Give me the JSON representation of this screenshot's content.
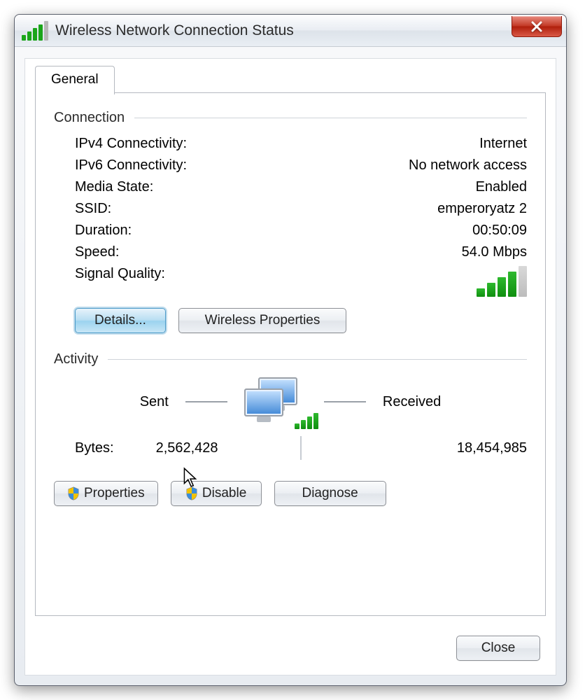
{
  "window": {
    "title": "Wireless Network Connection Status"
  },
  "tabs": {
    "general": "General"
  },
  "connection": {
    "heading": "Connection",
    "ipv4_label": "IPv4 Connectivity:",
    "ipv4_value": "Internet",
    "ipv6_label": "IPv6 Connectivity:",
    "ipv6_value": "No network access",
    "media_label": "Media State:",
    "media_value": "Enabled",
    "ssid_label": "SSID:",
    "ssid_value": "emperoryatz 2",
    "duration_label": "Duration:",
    "duration_value": "00:50:09",
    "speed_label": "Speed:",
    "speed_value": "54.0 Mbps",
    "signal_label": "Signal Quality:"
  },
  "buttons": {
    "details": "Details...",
    "wireless_properties": "Wireless Properties",
    "properties": "Properties",
    "disable": "Disable",
    "diagnose": "Diagnose",
    "close": "Close"
  },
  "activity": {
    "heading": "Activity",
    "sent_label": "Sent",
    "received_label": "Received",
    "bytes_label": "Bytes:",
    "bytes_sent": "2,562,428",
    "bytes_received": "18,454,985"
  }
}
